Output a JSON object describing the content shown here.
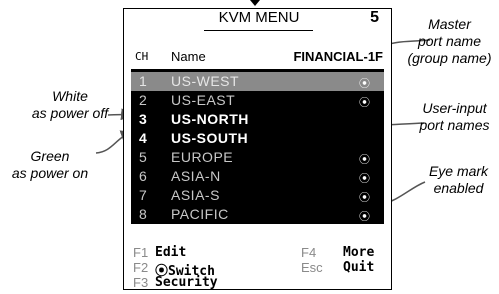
{
  "menu": {
    "title": "KVM MENU",
    "page_number": "5",
    "header": {
      "ch": "CH",
      "name": "Name",
      "group": "FINANCIAL-1F"
    },
    "rows": [
      {
        "num": "1",
        "name": "US-WEST",
        "eye": "⦿",
        "state": "selected"
      },
      {
        "num": "2",
        "name": "US-EAST",
        "eye": "⦿",
        "state": "on"
      },
      {
        "num": "3",
        "name": "US-NORTH",
        "eye": "",
        "state": "off"
      },
      {
        "num": "4",
        "name": "US-SOUTH",
        "eye": "",
        "state": "on"
      },
      {
        "num": "5",
        "name": "EUROPE",
        "eye": "⦿",
        "state": "on"
      },
      {
        "num": "6",
        "name": "ASIA-N",
        "eye": "⦿",
        "state": "on"
      },
      {
        "num": "7",
        "name": "ASIA-S",
        "eye": "⦿",
        "state": "on"
      },
      {
        "num": "8",
        "name": "PACIFIC",
        "eye": "⦿",
        "state": "on"
      }
    ],
    "footer": {
      "f1_key": "F1",
      "f1_label": "Edit",
      "f2_key": "F2",
      "f2_label": "⦿Switch",
      "f3_key": "F3",
      "f3_label": "Security",
      "f4_key": "F4",
      "f4_label": "More",
      "esc_key": "Esc",
      "esc_label": "Quit"
    }
  },
  "annotations": {
    "white": "White\nas power off",
    "green": "Green\nas power on",
    "master": "Master\nport name\n(group name)",
    "user_input": "User-input\nport names",
    "eye_mark": "Eye mark\nenabled"
  },
  "colors": {
    "list_bg": "#000000",
    "selected_bg": "#8a8a8a",
    "power_on": "#c8c8c8",
    "power_off": "#ffffff"
  }
}
